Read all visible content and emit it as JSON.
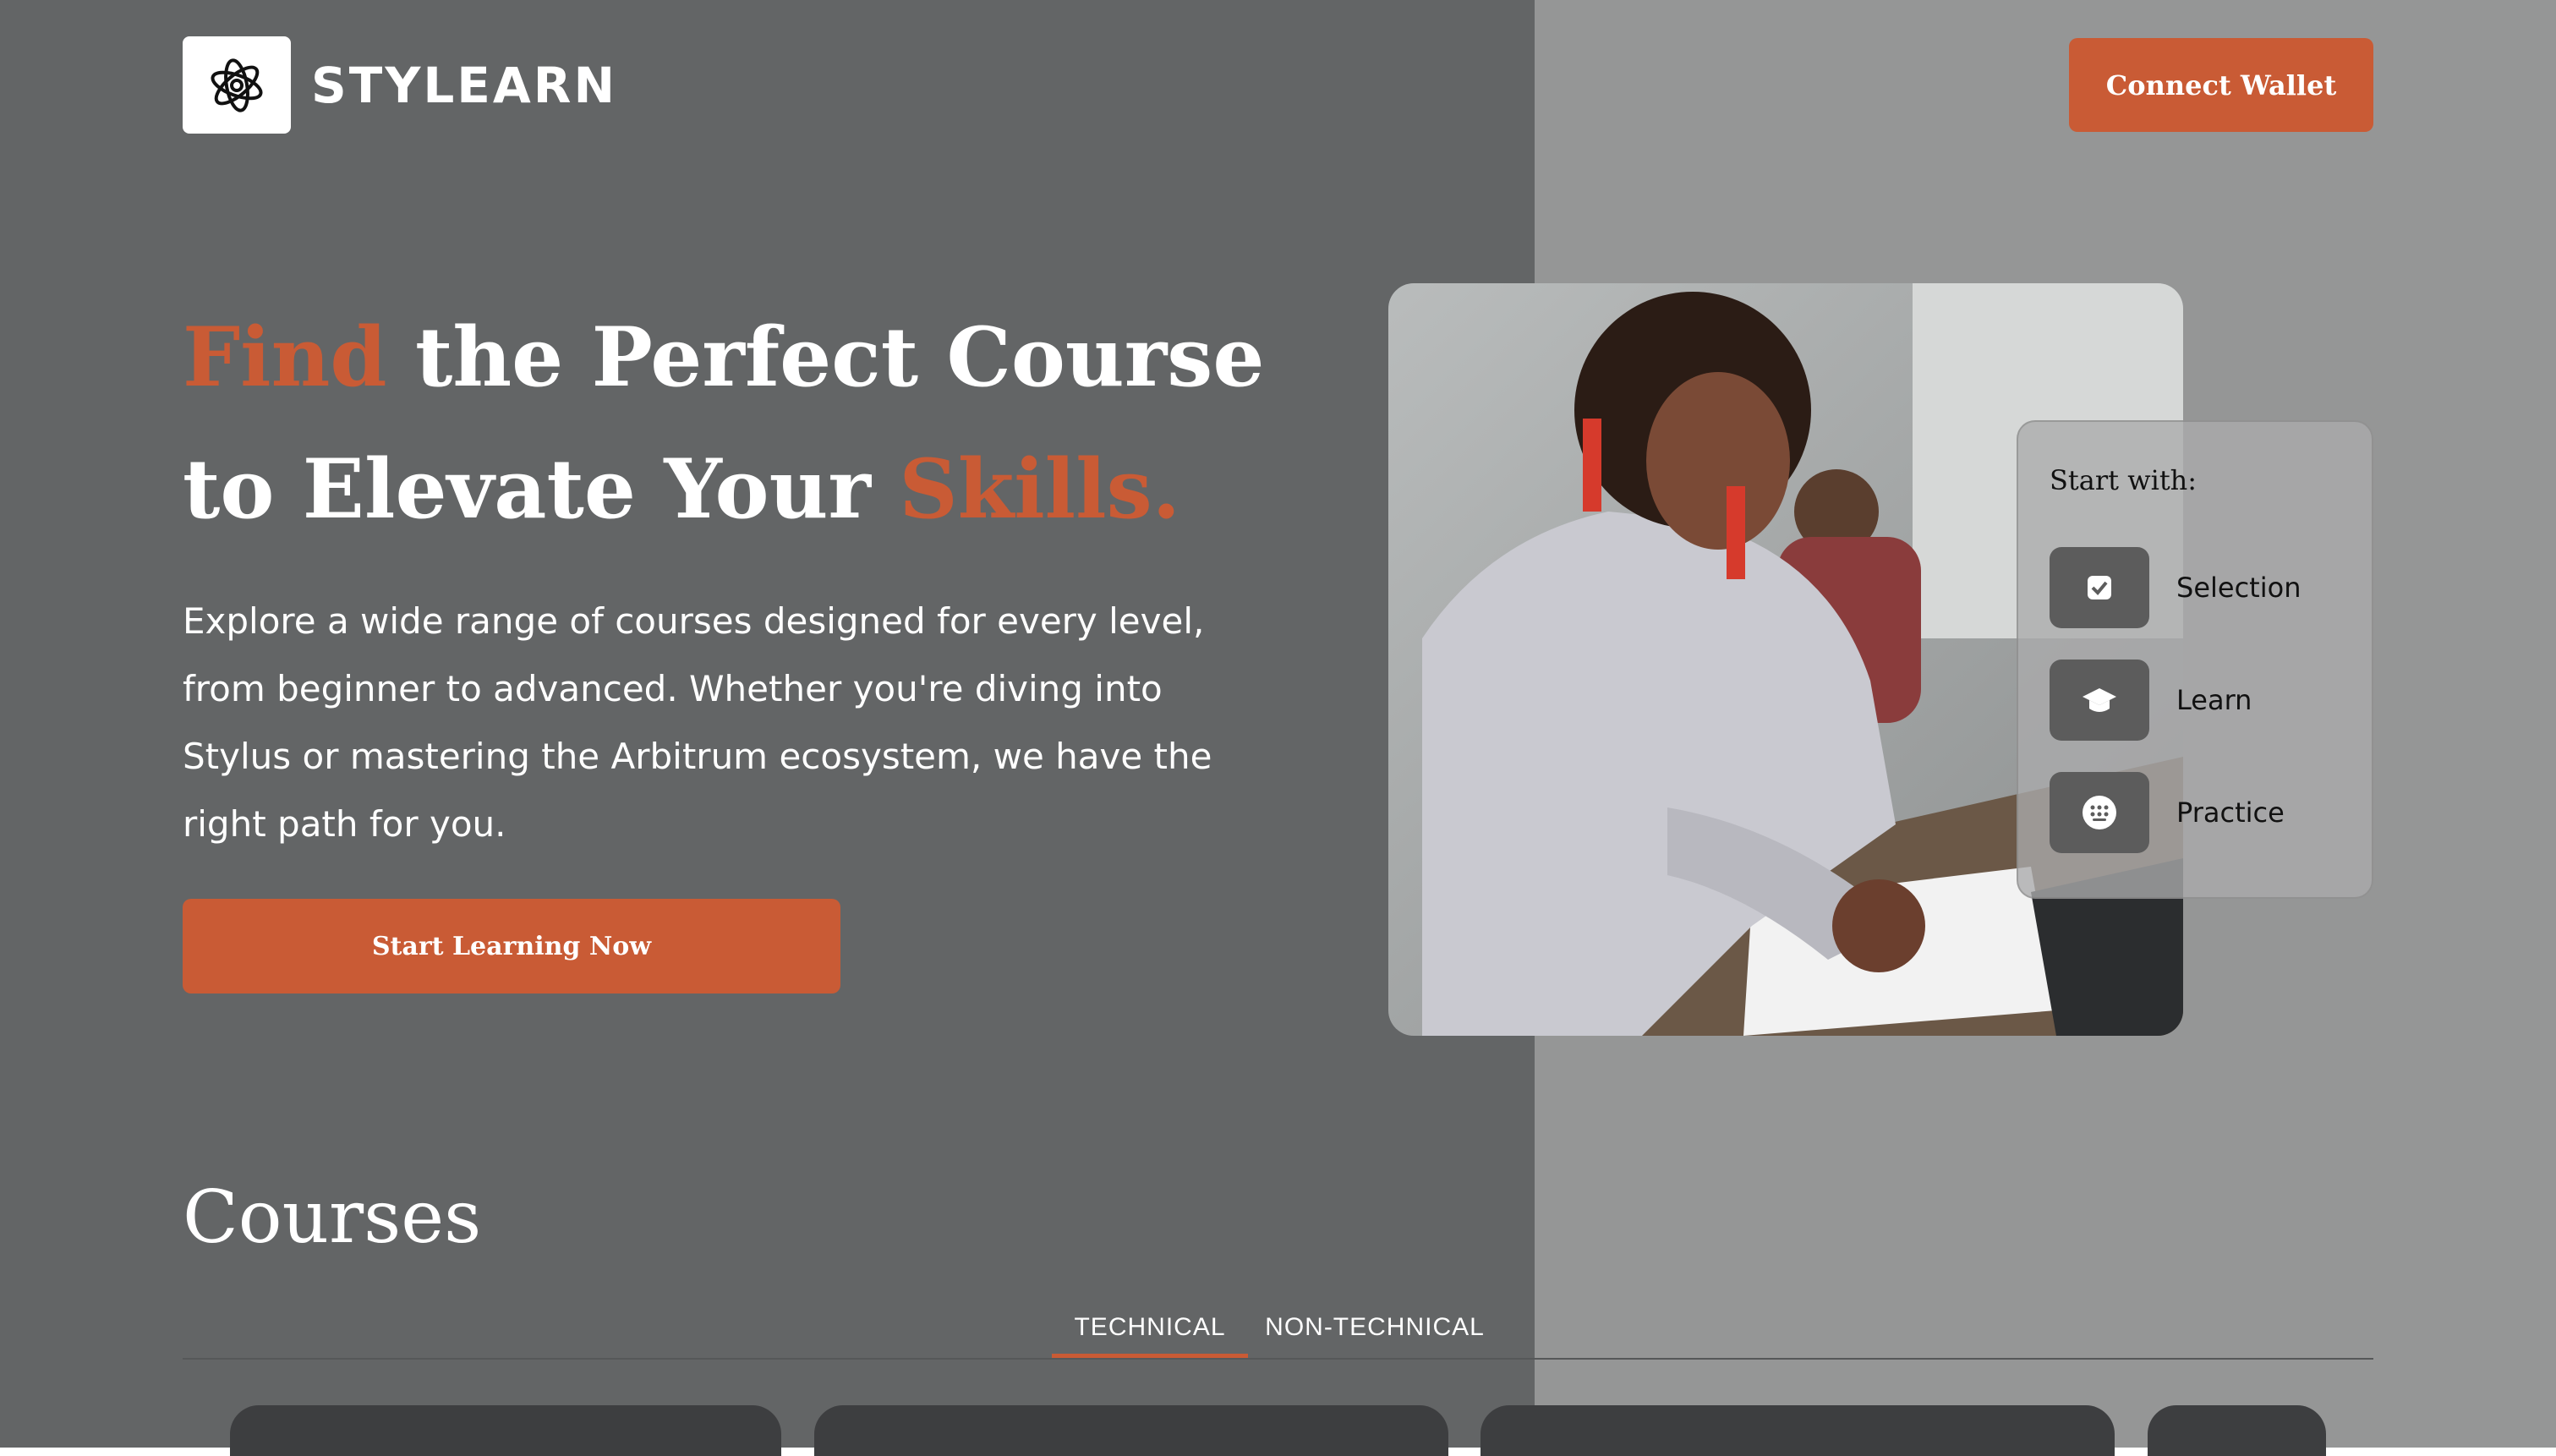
{
  "header": {
    "brand": "STYLEARN",
    "connect_wallet_label": "Connect Wallet"
  },
  "hero": {
    "title_part1": "Find",
    "title_part2": " the Perfect Course",
    "title_part3": "to Elevate Your ",
    "title_part4": "Skills.",
    "description": "Explore a wide range of courses designed for every level, from beginner to advanced. Whether you're diving into Stylus or mastering the Arbitrum ecosystem, we have the right path for you.",
    "cta_label": "Start Learning Now"
  },
  "start_with": {
    "title": "Start with:",
    "steps": [
      {
        "label": "Selection",
        "icon": "checkbox-icon"
      },
      {
        "label": "Learn",
        "icon": "graduation-cap-icon"
      },
      {
        "label": "Practice",
        "icon": "keypad-icon"
      }
    ]
  },
  "courses": {
    "title": "Courses",
    "tabs": [
      {
        "label": "TECHNICAL",
        "active": true
      },
      {
        "label": "NON-TECHNICAL",
        "active": false
      }
    ]
  },
  "colors": {
    "accent": "#c95b35",
    "overlay_left": "#636566",
    "overlay_right": "#959696"
  }
}
